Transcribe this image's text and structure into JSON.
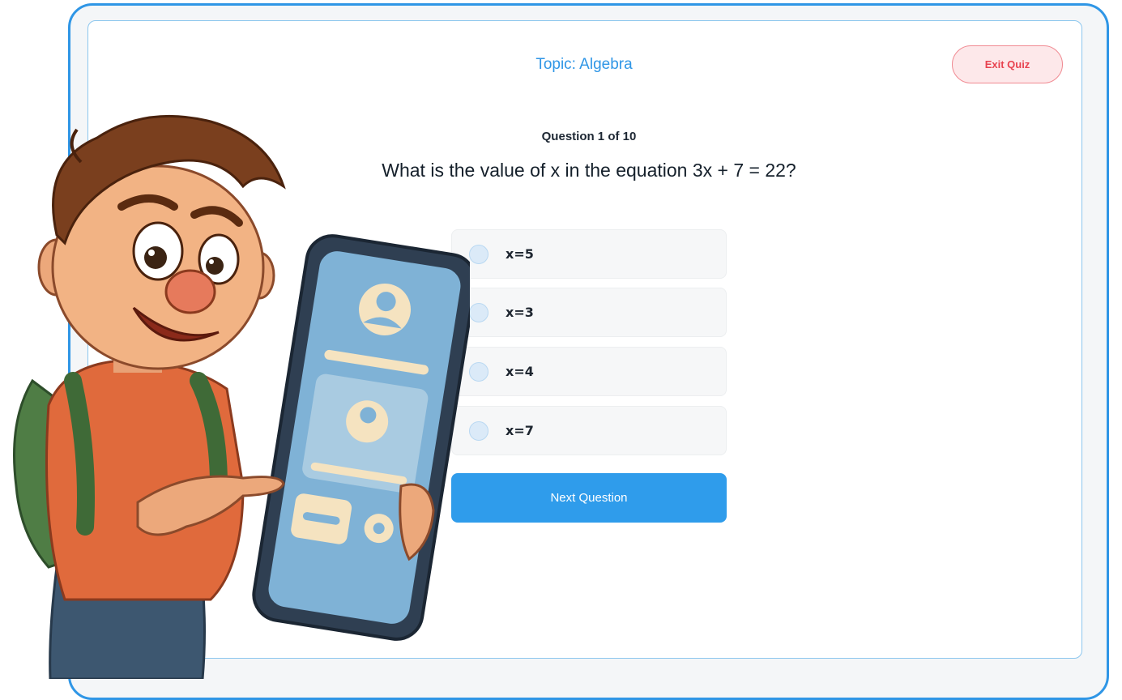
{
  "quiz": {
    "topic": "Topic: Algebra",
    "exit_label": "Exit Quiz",
    "counter": "Question 1 of 10",
    "question": "What is the value of x in the equation 3x + 7 = 22?",
    "options": [
      "x=5",
      "x=3",
      "x=4",
      "x=7"
    ],
    "next_label": "Next Question"
  },
  "colors": {
    "accent": "#2f96e6",
    "exit": "#e8424f"
  },
  "illustration": {
    "subject": "cartoon student holding a phone",
    "icons": [
      "user-icon",
      "gear-icon"
    ]
  }
}
